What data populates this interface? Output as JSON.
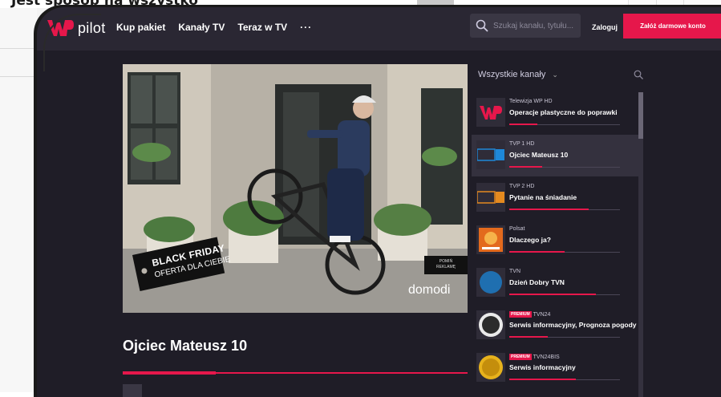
{
  "background_page": {
    "heading": "Jest sposób na wszystko"
  },
  "header": {
    "logo_text": "pilot",
    "nav": [
      "Kup pakiet",
      "Kanały TV",
      "Teraz w TV"
    ],
    "more": "···",
    "search_placeholder": "Szukaj kanału, tytułu...",
    "login": "Zaloguj",
    "cta": "Załóż darmowe konto"
  },
  "player": {
    "ad_badge": "POMIŃ\nREKLAMĘ",
    "ad_brand": "domodi",
    "promo_title": "BLACK FRIDAY",
    "promo_sub": "OFERTA DLA CIEBIE",
    "progress": 0.27
  },
  "current": {
    "title": "Ojciec Mateusz 10"
  },
  "channels_panel": {
    "header": "Wszystkie kanały",
    "items": [
      {
        "name": "Telewizja WP HD",
        "program": "Operacje plastyczne do poprawki",
        "progress": 0.25,
        "premium": false,
        "active": false,
        "logo": "WP"
      },
      {
        "name": "TVP 1 HD",
        "program": "Ojciec Mateusz 10",
        "progress": 0.3,
        "premium": false,
        "active": true,
        "logo": "TVP1"
      },
      {
        "name": "TVP 2 HD",
        "program": "Pytanie na śniadanie",
        "progress": 0.72,
        "premium": false,
        "active": false,
        "logo": "TVP2"
      },
      {
        "name": "Polsat",
        "program": "Dlaczego ja?",
        "progress": 0.5,
        "premium": false,
        "active": false,
        "logo": "POLSAT"
      },
      {
        "name": "TVN",
        "program": "Dzień Dobry TVN",
        "progress": 0.78,
        "premium": false,
        "active": false,
        "logo": "TVN"
      },
      {
        "name": "TVN24",
        "program": "Serwis informacyjny, Prognoza pogody",
        "progress": 0.35,
        "premium": true,
        "premium_label": "PREMIUM",
        "active": false,
        "logo": "TVN24"
      },
      {
        "name": "TVN24BIS",
        "program": "Serwis informacyjny",
        "progress": 0.6,
        "premium": true,
        "premium_label": "PREMIUM",
        "active": false,
        "logo": "TVN24BIS"
      }
    ]
  },
  "colors": {
    "accent": "#e6174b",
    "bg": "#1f1d27",
    "header": "#2a2733"
  }
}
